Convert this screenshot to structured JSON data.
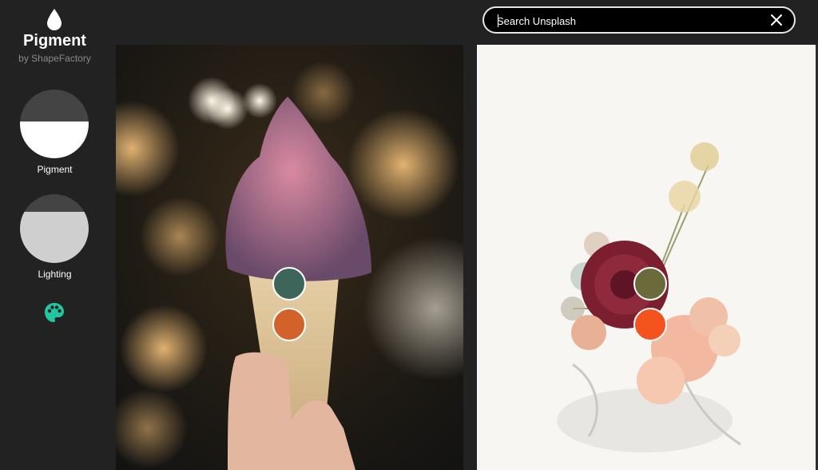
{
  "app": {
    "title": "Pigment",
    "subtitle": "by ShapeFactory"
  },
  "modes": [
    {
      "label": "Pigment",
      "colors": {
        "top": "#444444",
        "bottom": "#ffffff"
      }
    },
    {
      "label": "Lighting",
      "colors": {
        "top": "#444444",
        "bottom": "#cfcfcf"
      }
    }
  ],
  "palette_icon": {
    "name": "palette-icon",
    "color": "#22c7a0"
  },
  "search": {
    "placeholder": "Search Unsplash",
    "value": ""
  },
  "photos": [
    {
      "subject": "ice cream cone with sprinkles",
      "swatches": [
        "#3e655a",
        "#d3622a"
      ]
    },
    {
      "subject": "flower bouquet",
      "swatches": [
        "#6a6a3a",
        "#f4531e"
      ]
    }
  ]
}
